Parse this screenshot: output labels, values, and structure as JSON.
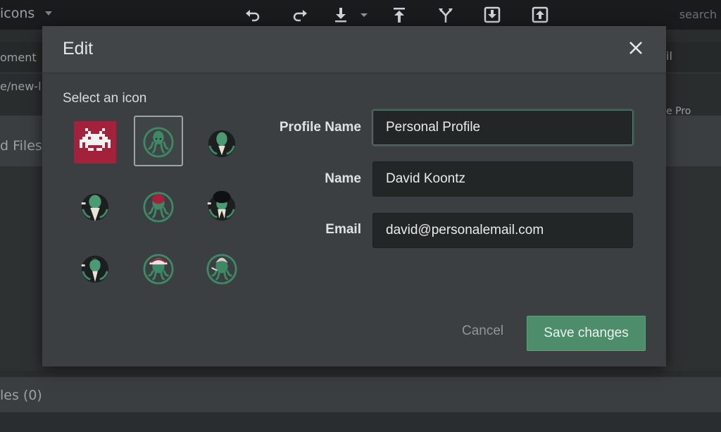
{
  "app": {
    "repo_title": "icons",
    "search_placeholder": "search",
    "toolbar_icons": [
      "undo-icon",
      "redo-icon",
      "pull-icon",
      "push-icon",
      "branch-icon",
      "stash-icon",
      "pop-icon"
    ]
  },
  "background": {
    "col_header": "oment",
    "branch_fragment": "e/new-l",
    "right_fragment_1": "il",
    "right_fragment_2": "e Pro",
    "staged_files": "d Files",
    "unstaged_files": "les (0)"
  },
  "modal": {
    "title": "Edit",
    "select_icon_label": "Select an icon",
    "icons": [
      {
        "name": "space-invader-icon",
        "selected": false
      },
      {
        "name": "kraken-green-icon",
        "selected": true
      },
      {
        "name": "kraken-beaked-icon",
        "selected": false
      },
      {
        "name": "kraken-bearded-icon",
        "selected": false
      },
      {
        "name": "kraken-red-hair-icon",
        "selected": false
      },
      {
        "name": "kraken-afro-icon",
        "selected": false
      },
      {
        "name": "kraken-punk-icon",
        "selected": false
      },
      {
        "name": "kraken-hat-icon",
        "selected": false
      },
      {
        "name": "kraken-mohawk-icon",
        "selected": false
      }
    ],
    "fields": {
      "profile_name": {
        "label": "Profile Name",
        "value": "Personal Profile"
      },
      "name": {
        "label": "Name",
        "value": "David Koontz"
      },
      "email": {
        "label": "Email",
        "value": "david@personalemail.com"
      }
    },
    "cancel_label": "Cancel",
    "save_label": "Save changes"
  },
  "colors": {
    "accent_green": "#4e8d6c",
    "space_invader_red": "#a3213a",
    "kraken_green": "#3e8865"
  }
}
